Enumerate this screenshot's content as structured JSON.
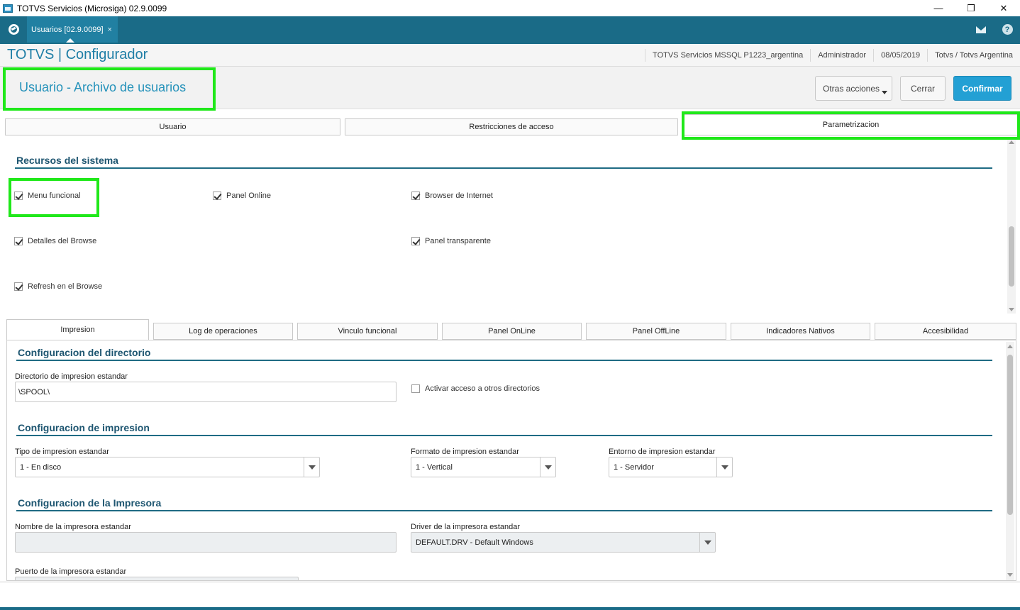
{
  "window": {
    "title": "TOTVS Servicios (Microsiga) 02.9.0099",
    "min": "—",
    "restore": "❐",
    "close": "✕"
  },
  "tabbar": {
    "tab_label": "Usuarios [02.9.0099]",
    "tab_close": "×",
    "help": "?"
  },
  "header": {
    "brand": "TOTVS | Configurador",
    "env": "TOTVS Servicios MSSQL P1223_argentina",
    "user": "Administrador",
    "date": "08/05/2019",
    "company": "Totvs / Totvs Argentina"
  },
  "page": {
    "title": "Usuario - Archivo de usuarios",
    "buttons": {
      "other": "Otras acciones",
      "close": "Cerrar",
      "confirm": "Confirmar"
    }
  },
  "main_tabs": [
    "Usuario",
    "Restricciones de acceso",
    "Parametrizacion"
  ],
  "recursos": {
    "title": "Recursos del sistema",
    "items": [
      {
        "label": "Menu funcional",
        "checked": true
      },
      {
        "label": "Panel Online",
        "checked": true
      },
      {
        "label": "Browser de Internet",
        "checked": true
      },
      {
        "label": "Detalles del Browse",
        "checked": true
      },
      {
        "label": "Panel transparente",
        "checked": true
      },
      {
        "label": "Refresh en el Browse",
        "checked": true
      }
    ]
  },
  "sub_tabs": [
    "Impresion",
    "Log de operaciones",
    "Vinculo funcional",
    "Panel OnLine",
    "Panel OffLine",
    "Indicadores Nativos",
    "Accesibilidad"
  ],
  "impresion": {
    "dir_section": "Configuracion del directorio",
    "dir_label": "Directorio de impresion estandar",
    "dir_value": "\\SPOOL\\",
    "other_dirs_label": "Activar acceso a otros directorios",
    "print_section": "Configuracion de impresion",
    "tipo_label": "Tipo de impresion estandar",
    "tipo_value": "1 - En disco",
    "formato_label": "Formato de impresion estandar",
    "formato_value": "1 - Vertical",
    "entorno_label": "Entorno de impresion estandar",
    "entorno_value": "1 - Servidor",
    "printer_section": "Configuracion de la Impresora",
    "nombre_label": "Nombre de la impresora estandar",
    "nombre_value": "",
    "driver_label": "Driver de la impresora estandar",
    "driver_value": "DEFAULT.DRV - Default Windows",
    "puerto_label": "Puerto de la impresora estandar"
  },
  "colors": {
    "teal": "#1a6b87",
    "accent": "#23a0d4",
    "highlight": "#20e81a"
  }
}
